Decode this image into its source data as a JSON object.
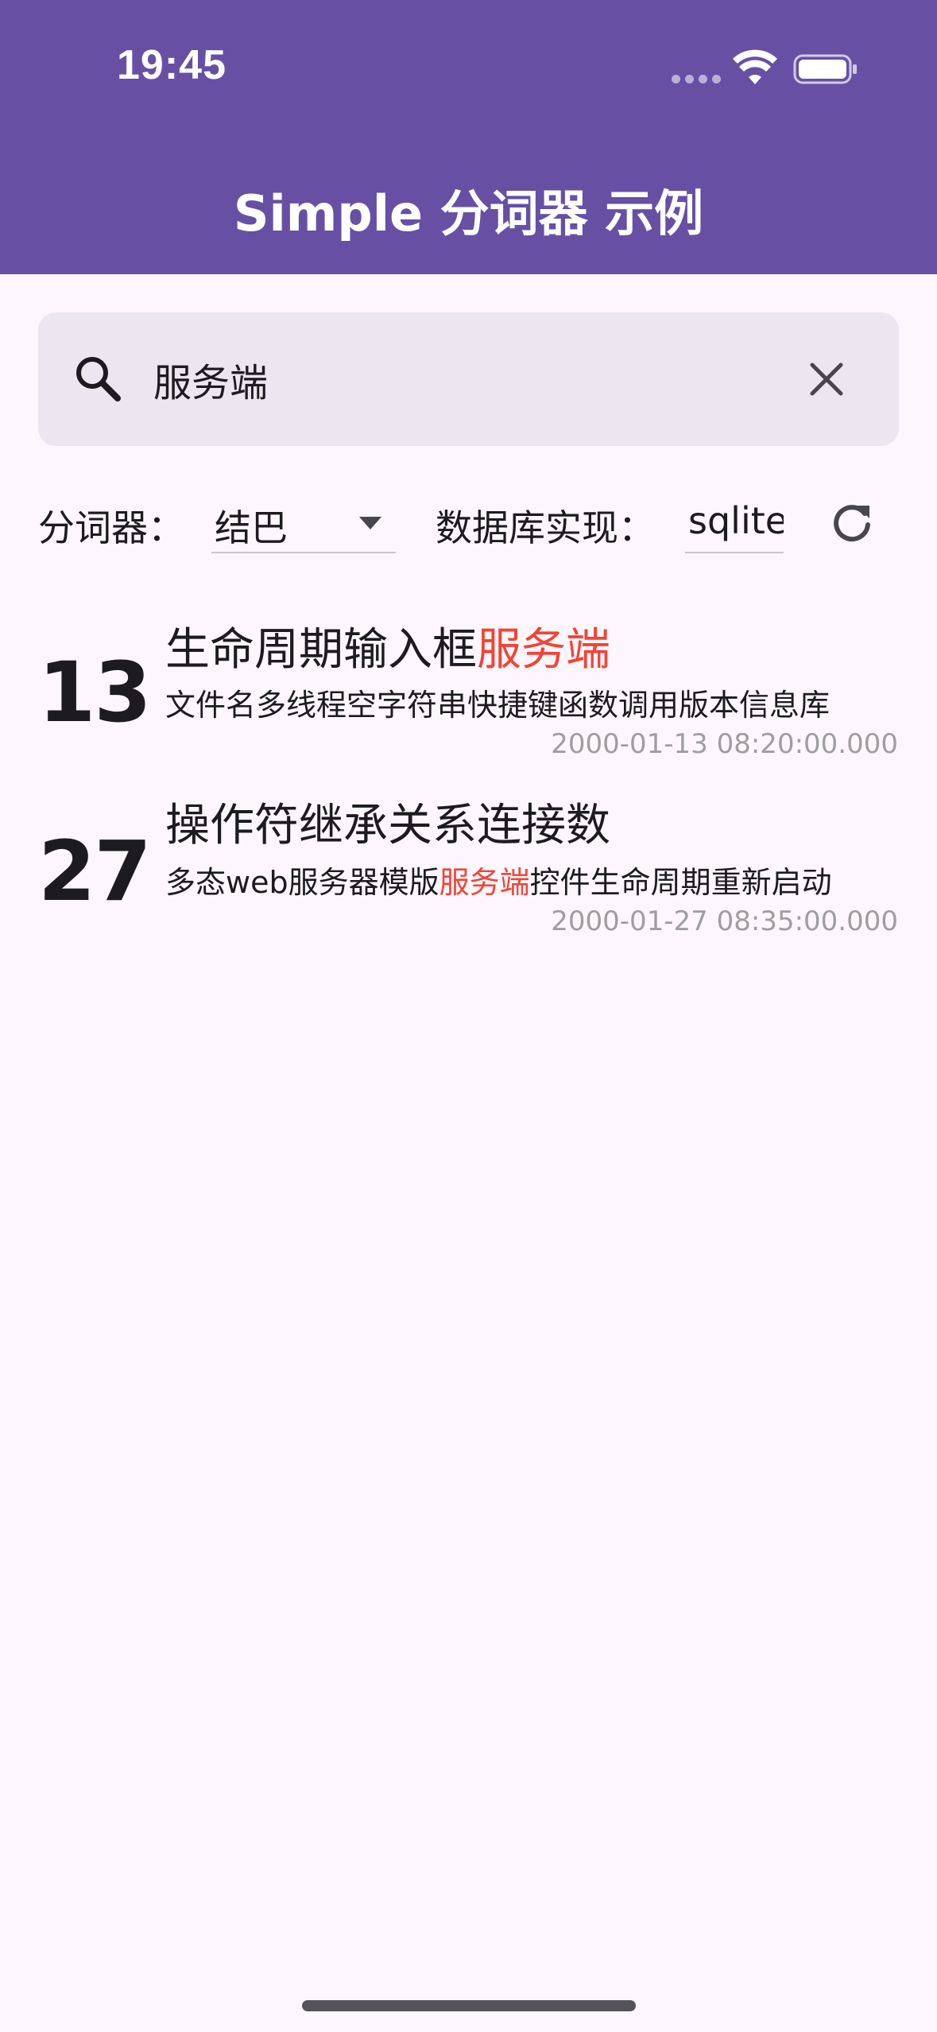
{
  "status_bar": {
    "time": "19:45"
  },
  "app_bar": {
    "title": "Simple 分词器 示例",
    "color": "#6750A4"
  },
  "search": {
    "value": "服务端",
    "search_icon": "search-icon",
    "clear_icon": "close-icon"
  },
  "controls": {
    "tokenizer_label": "分词器：",
    "tokenizer_value": "结巴",
    "db_label": "数据库实现：",
    "db_value": "sqlite",
    "refresh_icon": "refresh-icon"
  },
  "results": [
    {
      "day": "13",
      "title_parts": [
        {
          "text": "生命周期输入框",
          "highlight": false
        },
        {
          "text": "服务端",
          "highlight": true
        }
      ],
      "snippet_parts": [
        {
          "text": "文件名多线程空字符串快捷键函数调用版本信息库",
          "highlight": false
        }
      ],
      "date": "2000-01-13 08:20:00.000"
    },
    {
      "day": "27",
      "title_parts": [
        {
          "text": "操作符继承关系连接数",
          "highlight": false
        }
      ],
      "snippet_parts": [
        {
          "text": "多态web服务器模版",
          "highlight": false
        },
        {
          "text": "服务端",
          "highlight": true
        },
        {
          "text": "控件生命周期重新启动",
          "highlight": false
        }
      ],
      "date": "2000-01-27 08:35:00.000"
    }
  ],
  "colors": {
    "highlight": "#F44336",
    "background": "#FDF7FD",
    "search_fill": "#ECE6F0",
    "date_text": "#9E9E9E"
  }
}
